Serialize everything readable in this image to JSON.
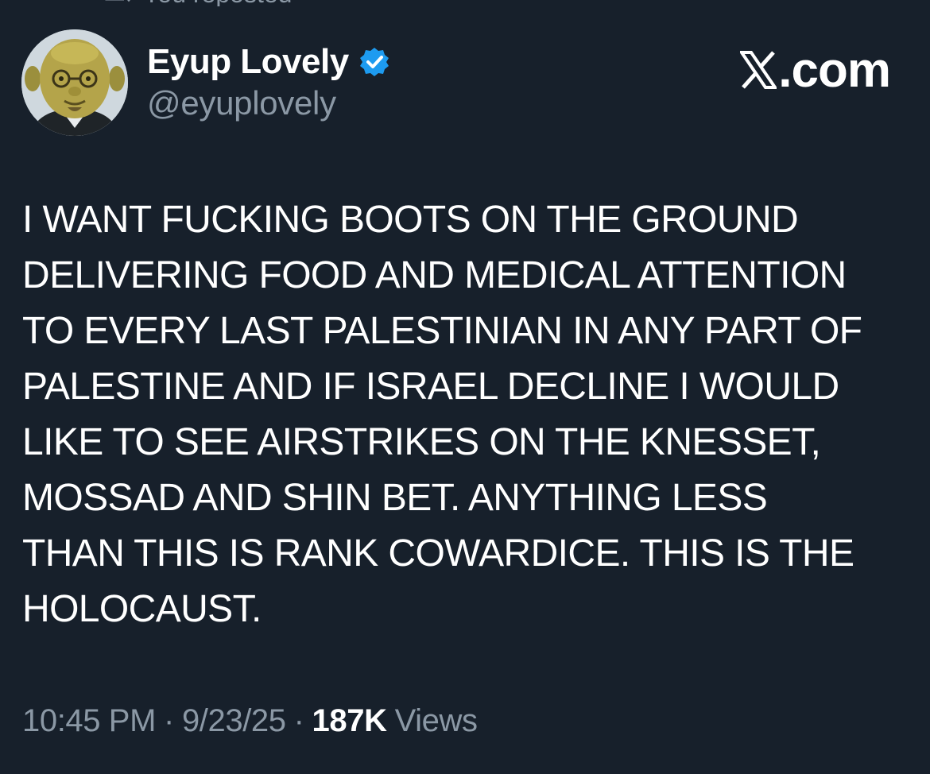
{
  "repost_hint": {
    "label": "You reposted",
    "icon": "repost-icon"
  },
  "author": {
    "avatar_icon": "avatar",
    "display_name": "Eyup Lovely",
    "verified_icon": "verified-badge-icon",
    "handle": "@eyuplovely"
  },
  "brand": {
    "icon": "x-logo-icon",
    "domain": ".com"
  },
  "tweet": {
    "lines": [
      "I WANT FUCKING BOOTS ON THE GROUND",
      "DELIVERING FOOD AND MEDICAL ATTENTION",
      "TO EVERY LAST PALESTINIAN IN ANY PART OF",
      "PALESTINE AND IF ISRAEL DECLINE I WOULD",
      "LIKE TO SEE AIRSTRIKES ON THE KNESSET,",
      "MOSSAD AND SHIN BET. ANYTHING LESS",
      "THAN THIS IS RANK COWARDICE. THIS IS THE",
      "HOLOCAUST."
    ]
  },
  "meta": {
    "time": "10:45 PM",
    "separator": "·",
    "date": "9/23/25",
    "views_count": "187K",
    "views_label": "Views"
  },
  "colors": {
    "background": "#17202b",
    "text": "#ffffff",
    "secondary_text": "#8b98a5",
    "verified": "#1d9bf0"
  }
}
